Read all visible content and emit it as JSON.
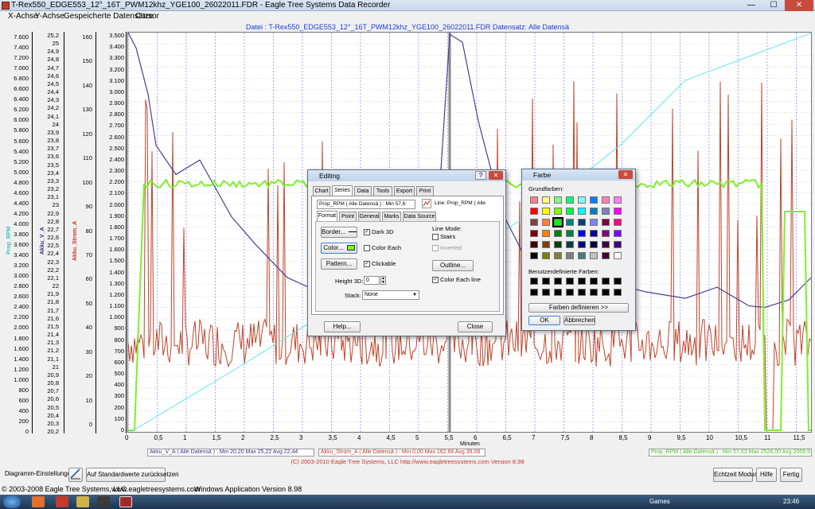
{
  "window": {
    "title": "T-Rex550_EDGE553_12°_16T_PWM12khz_YGE100_26022011.FDR - Eagle Tree Systems Data Recorder",
    "minimize": "—",
    "maximize": "☐",
    "close": "✕"
  },
  "menu": [
    "X-Achse",
    "Y-Achse",
    "Gespeicherte Datensätze",
    "Cursor"
  ],
  "chart_header": "Datei : T-Rex550_EDGE553_12°_16T_PWM12khz_YGE100_26022011.FDR  Datensatz: Alle Datensä",
  "axes": {
    "akku_v": {
      "label": "Akku_V_A",
      "ticks": [
        "25,2",
        "25",
        "24,9",
        "24,8",
        "24,7",
        "24,6",
        "24,5",
        "24,4",
        "24,3",
        "24,2",
        "24,1",
        "24",
        "23,9",
        "23,8",
        "23,7",
        "23,6",
        "23,5",
        "23,4",
        "23,3",
        "23,2",
        "23,1",
        "23",
        "22,9",
        "22,8",
        "22,7",
        "22,6",
        "22,5",
        "22,4",
        "22,3",
        "22,2",
        "22,1",
        "22",
        "21,9",
        "21,8",
        "21,7",
        "21,6",
        "21,5",
        "21,4",
        "21,3",
        "21,2",
        "21,1",
        "21",
        "20,9",
        "20,8",
        "20,7",
        "20,6",
        "20,5",
        "20,4",
        "20,3",
        "20,2"
      ]
    },
    "rpm": {
      "label": "Prop_RPM",
      "ticks": [
        "7.600",
        "7.400",
        "7.200",
        "7.000",
        "6.800",
        "6.600",
        "6.400",
        "6.200",
        "6.000",
        "5.800",
        "5.600",
        "5.400",
        "5.200",
        "5.000",
        "4.800",
        "4.600",
        "4.400",
        "4.200",
        "4.000",
        "3.800",
        "3.600",
        "3.400",
        "3.200",
        "3.000",
        "2.800",
        "2.600",
        "2.400",
        "2.200",
        "2.000",
        "1.800",
        "1.600",
        "1.400",
        "1.200",
        "1.000",
        "800",
        "600",
        "400",
        "200",
        "0"
      ]
    },
    "strom": {
      "label": "Akku_Strom_A",
      "ticks": [
        "160",
        "150",
        "140",
        "130",
        "120",
        "110",
        "100",
        "90",
        "80",
        "70",
        "60",
        "50",
        "40",
        "30",
        "20",
        "10",
        "0"
      ]
    },
    "primary": {
      "ticks": [
        "3.500",
        "3.400",
        "3.300",
        "3.200",
        "3.100",
        "3.000",
        "2.900",
        "2.800",
        "2.700",
        "2.600",
        "2.500",
        "2.400",
        "2.300",
        "2.200",
        "2.100",
        "2.000",
        "1.900",
        "1.800",
        "1.700",
        "1.600",
        "1.500",
        "1.400",
        "1.300",
        "1.200",
        "1.100",
        "1.000",
        "900",
        "800",
        "700",
        "600",
        "500",
        "400",
        "300",
        "200",
        "100",
        "0"
      ]
    },
    "x": {
      "label": "Minuten",
      "ticks": [
        "0",
        "0,5",
        "1",
        "1,5",
        "2",
        "2,5",
        "3",
        "3,5",
        "4",
        "4,5",
        "5",
        "5,5",
        "6",
        "6,5",
        "7",
        "7,5",
        "8",
        "8,5",
        "9",
        "9,5",
        "10",
        "10,5",
        "11",
        "11,5"
      ]
    }
  },
  "legend": [
    {
      "text": "Akku_V_A ( Alle Datensä ) : Min 20,20   Max 25,22   Avg 22,44",
      "color": "#3a2f8c"
    },
    {
      "text": "Akku_Strom_A ( Alle Datensä ) : Min 0,00   Max 162,66   Avg 39,08",
      "color": "#c0392b"
    },
    {
      "text": "Prop_RPM ( Alle Datensä ) : Min 57,63   Max 2526,00   Avg 2069,9",
      "color": "#3fc21e"
    }
  ],
  "copyright_line": "(C) 2003-2010 Eagle Tree Systems, LLC      http://www.eagletreesystems.com      Version 8.98",
  "bottom": {
    "diagram_label": "Diagramm-Einstellungen:",
    "reset_button": "Auf Standardwerte zurücksetzen",
    "realtime_button": "Echtzeit Modus",
    "help_button": "Hilfe",
    "done_button": "Fertig"
  },
  "status": {
    "company": "© 2003-2008 Eagle Tree Systems, LLC",
    "url": "www.eagletreesystems.com",
    "version": "Windows Application Version 8.98"
  },
  "taskbar": {
    "games_label": "Games",
    "time": "23:46"
  },
  "editing": {
    "title": "Editing",
    "help_btn": "?",
    "tabs": [
      "Chart",
      "Series",
      "Data",
      "Tools",
      "Export",
      "Print"
    ],
    "series_select": "Prop_RPM ( Alle Datensä ) : Min 57,6:",
    "line_label": "Line: Prop_RPM ( Alle",
    "subtabs": [
      "Format",
      "Point",
      "General",
      "Marks",
      "Data Source"
    ],
    "border_btn": "Border...",
    "color_btn": "Color...",
    "pattern_btn": "Pattern...",
    "dark3d": "Dark 3D",
    "color_each": "Color Each",
    "clickable": "Clickable",
    "line_mode": "Line Mode:",
    "stairs": "Stairs",
    "inverted": "Inverted",
    "outline_btn": "Outline...",
    "color_each_line": "Color Each line",
    "height3d_label": "Height 3D:",
    "height3d_value": "0",
    "stack_label": "Stack:",
    "stack_value": "None",
    "help_button": "Help...",
    "close_button": "Close"
  },
  "farbe": {
    "title": "Farbe",
    "basic_label": "Grundfarben:",
    "custom_label": "Benutzerdefinierte Farben:",
    "define_btn": "Farben definieren >>",
    "ok_btn": "OK",
    "cancel_btn": "Abbrechen",
    "basic_colors": [
      "#ff8080",
      "#ffff80",
      "#80ff80",
      "#00ff80",
      "#80ffff",
      "#0080ff",
      "#ff80c0",
      "#ff80ff",
      "#ff0000",
      "#ffff00",
      "#80ff00",
      "#00ff40",
      "#00ffff",
      "#0080c0",
      "#8080c0",
      "#ff00ff",
      "#804040",
      "#ff8040",
      "#00ff00",
      "#008080",
      "#004080",
      "#8080ff",
      "#800040",
      "#ff0080",
      "#800000",
      "#ff8000",
      "#008000",
      "#008040",
      "#0000ff",
      "#0000a0",
      "#800080",
      "#8000ff",
      "#400000",
      "#804000",
      "#004000",
      "#004040",
      "#000080",
      "#000040",
      "#400040",
      "#400080",
      "#000000",
      "#808000",
      "#808040",
      "#808080",
      "#408080",
      "#c0c0c0",
      "#400040",
      "#ffffff"
    ],
    "selected_index": 18
  }
}
